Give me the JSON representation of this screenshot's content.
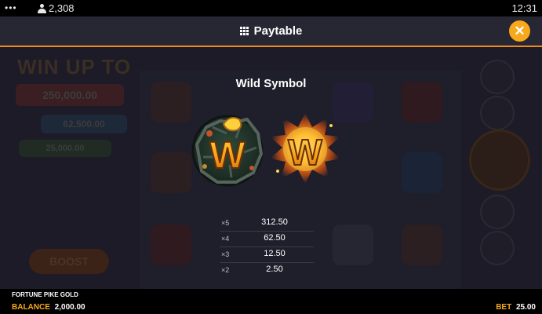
{
  "status": {
    "menu_dots": "•••",
    "player_count": "2,308",
    "time": "12:31"
  },
  "header": {
    "title": "Paytable",
    "close_glyph": "✕"
  },
  "background": {
    "win_banner": "WIN UP TO",
    "pill_1": "250,000.00",
    "pill_2": "62,500.00",
    "pill_3": "25,000.00",
    "boost": "BOOST"
  },
  "section": {
    "title": "Wild Symbol",
    "symbols": [
      {
        "name": "stone-wild",
        "letter": "W"
      },
      {
        "name": "fire-wild",
        "letter": "W"
      }
    ],
    "payouts": [
      {
        "multiplier": "×5",
        "value": "312.50"
      },
      {
        "multiplier": "×4",
        "value": "62.50"
      },
      {
        "multiplier": "×3",
        "value": "12.50"
      },
      {
        "multiplier": "×2",
        "value": "2.50"
      }
    ]
  },
  "footer": {
    "game_name": "FORTUNE PIKE GOLD",
    "balance_label": "BALANCE",
    "balance_value": "2,000.00",
    "bet_label": "BET",
    "bet_value": "25.00"
  },
  "colors": {
    "accent": "#f7a81b",
    "header_bg": "#272633",
    "divider": "#f08a1c"
  }
}
